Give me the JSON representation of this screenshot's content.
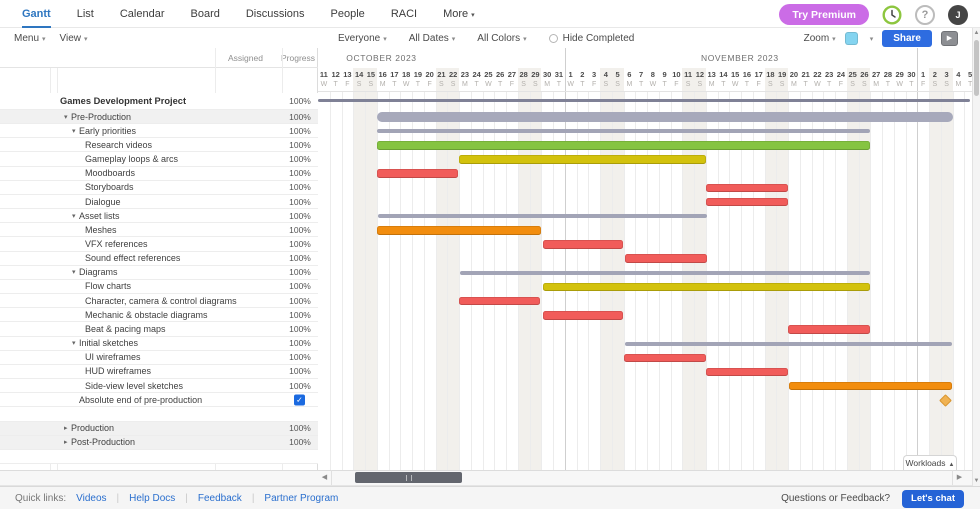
{
  "nav": {
    "tabs": [
      {
        "label": "Gantt",
        "active": true
      },
      {
        "label": "List",
        "active": false
      },
      {
        "label": "Calendar",
        "active": false
      },
      {
        "label": "Board",
        "active": false
      },
      {
        "label": "Discussions",
        "active": false
      },
      {
        "label": "People",
        "active": false
      },
      {
        "label": "RACI",
        "active": false
      },
      {
        "label": "More",
        "active": false,
        "caret": true
      }
    ],
    "try_premium_label": "Try Premium",
    "help_icon_glyph": "?",
    "avatar_initial": "J"
  },
  "toolbar": {
    "menu_label": "Menu",
    "view_label": "View",
    "everyone_label": "Everyone",
    "all_dates_label": "All Dates",
    "all_colors_label": "All Colors",
    "hide_completed_label": "Hide Completed",
    "zoom_label": "Zoom",
    "share_label": "Share"
  },
  "panel_columns": {
    "assigned": "Assigned",
    "progress": "Progress"
  },
  "workloads_label": "Workloads",
  "footer": {
    "quick_links_label": "Quick links:",
    "links": [
      "Videos",
      "Help Docs",
      "Feedback",
      "Partner Program"
    ],
    "question_label": "Questions or Feedback?",
    "chat_button_label": "Let's chat"
  },
  "colors": {
    "brand_blue": "#2e76c0",
    "premium_purple": "#cb6ce6",
    "share_blue": "#2e6ce0",
    "chat_blue": "#2563d6",
    "clock_green": "#8dc63f",
    "bar_green": "#85c441",
    "bar_yellow": "#d3c20d",
    "bar_red": "#f15c5a",
    "bar_orange": "#f28d0e",
    "bar_group_gray": "#a2a4b6",
    "bar_parent_gray": "#a7a9bb",
    "project_gray": "#7f8196",
    "milestone_orange": "#f0b252",
    "weekend_shade": "#f2f0ec",
    "checkbox_blue": "#1b6ae0"
  },
  "chart_data": {
    "type": "gantt",
    "title": "Games Development Project",
    "timeline": {
      "day_width": 11.75,
      "start_day_label": "Oct 11 2023 (W)",
      "months": [
        {
          "label": "OCTOBER 2023",
          "first_day": 11,
          "weekday_letters": "WTFSSMTWTFSSMTWTFSSMT",
          "label_center_day": 5.4
        },
        {
          "label": "NOVEMBER 2023",
          "first_day": 1,
          "weekday_letters": "WTFSSMTWTFSSMTWTFSSMTWTFSSMTWT",
          "label_center_day": 35.9
        },
        {
          "label": "",
          "first_day": 1,
          "weekday_letters": "FSSMT",
          "label_center_day": null
        }
      ]
    },
    "tasks": [
      {
        "id": "games-development-project",
        "label": "Games Development Project",
        "indent": 0,
        "bold": true,
        "progress": "100%",
        "bar": {
          "kind": "proj",
          "start": 0,
          "end": 55.5,
          "color_key": "project_gray"
        }
      },
      {
        "id": "pre-production",
        "label": "Pre-Production",
        "indent": 1,
        "caret": "down",
        "shaded": true,
        "progress": "100%",
        "bar": {
          "kind": "pill",
          "start": 5.0,
          "end": 54.0,
          "color_key": "bar_parent_gray"
        }
      },
      {
        "id": "early-priorities",
        "label": "Early priorities",
        "indent": 2,
        "caret": "down",
        "progress": "100%",
        "bar": {
          "kind": "group",
          "start": 5.0,
          "end": 47.0,
          "color_key": "bar_group_gray"
        }
      },
      {
        "id": "research-videos",
        "label": "Research videos",
        "indent": 3,
        "progress": "100%",
        "bar": {
          "kind": "task",
          "start": 5.0,
          "end": 47.0,
          "color_key": "bar_green"
        }
      },
      {
        "id": "gameplay-loops-arcs",
        "label": "Gameplay loops & arcs",
        "indent": 3,
        "progress": "100%",
        "bar": {
          "kind": "task",
          "start": 12.0,
          "end": 33.0,
          "color_key": "bar_yellow"
        }
      },
      {
        "id": "moodboards",
        "label": "Moodboards",
        "indent": 3,
        "progress": "100%",
        "bar": {
          "kind": "task",
          "start": 5.0,
          "end": 11.9,
          "color_key": "bar_red"
        }
      },
      {
        "id": "storyboards",
        "label": "Storyboards",
        "indent": 3,
        "progress": "100%",
        "bar": {
          "kind": "task",
          "start": 33.0,
          "end": 40.0,
          "color_key": "bar_red"
        }
      },
      {
        "id": "dialogue",
        "label": "Dialogue",
        "indent": 3,
        "progress": "100%",
        "bar": {
          "kind": "task",
          "start": 33.0,
          "end": 40.0,
          "color_key": "bar_red"
        }
      },
      {
        "id": "asset-lists",
        "label": "Asset lists",
        "indent": 2,
        "caret": "down",
        "progress": "100%",
        "bar": {
          "kind": "group",
          "start": 5.1,
          "end": 33.1,
          "color_key": "bar_group_gray"
        }
      },
      {
        "id": "meshes",
        "label": "Meshes",
        "indent": 3,
        "progress": "100%",
        "bar": {
          "kind": "task",
          "start": 5.0,
          "end": 19.0,
          "color_key": "bar_orange"
        }
      },
      {
        "id": "vfx-references",
        "label": "VFX references",
        "indent": 3,
        "progress": "100%",
        "bar": {
          "kind": "task",
          "start": 19.15,
          "end": 26.0,
          "color_key": "bar_red"
        }
      },
      {
        "id": "sound-effect-references",
        "label": "Sound effect references",
        "indent": 3,
        "progress": "100%",
        "bar": {
          "kind": "task",
          "start": 26.1,
          "end": 33.1,
          "color_key": "bar_red"
        }
      },
      {
        "id": "diagrams",
        "label": "Diagrams",
        "indent": 2,
        "caret": "down",
        "progress": "100%",
        "bar": {
          "kind": "group",
          "start": 12.05,
          "end": 47.0,
          "color_key": "bar_group_gray"
        }
      },
      {
        "id": "flow-charts",
        "label": "Flow charts",
        "indent": 3,
        "progress": "100%",
        "bar": {
          "kind": "task",
          "start": 19.15,
          "end": 47.0,
          "color_key": "bar_yellow"
        }
      },
      {
        "id": "character-camera-control-diagrams",
        "label": "Character, camera & control diagrams",
        "indent": 3,
        "progress": "100%",
        "bar": {
          "kind": "task",
          "start": 12.0,
          "end": 18.9,
          "color_key": "bar_red"
        }
      },
      {
        "id": "mechanic-obstacle-diagrams",
        "label": "Mechanic & obstacle diagrams",
        "indent": 3,
        "progress": "100%",
        "bar": {
          "kind": "task",
          "start": 19.15,
          "end": 26.0,
          "color_key": "bar_red"
        }
      },
      {
        "id": "beat-pacing-maps",
        "label": "Beat & pacing maps",
        "indent": 3,
        "progress": "100%",
        "bar": {
          "kind": "task",
          "start": 40.0,
          "end": 47.0,
          "color_key": "bar_red"
        }
      },
      {
        "id": "initial-sketches",
        "label": "Initial sketches",
        "indent": 2,
        "caret": "down",
        "progress": "100%",
        "bar": {
          "kind": "group",
          "start": 26.1,
          "end": 54.0,
          "color_key": "bar_group_gray"
        }
      },
      {
        "id": "ui-wireframes",
        "label": "UI wireframes",
        "indent": 3,
        "progress": "100%",
        "bar": {
          "kind": "task",
          "start": 26.0,
          "end": 33.0,
          "color_key": "bar_red"
        }
      },
      {
        "id": "hud-wireframes",
        "label": "HUD wireframes",
        "indent": 3,
        "progress": "100%",
        "bar": {
          "kind": "task",
          "start": 33.0,
          "end": 40.0,
          "color_key": "bar_red"
        }
      },
      {
        "id": "side-view-level-sketches",
        "label": "Side-view level sketches",
        "indent": 3,
        "progress": "100%",
        "bar": {
          "kind": "task",
          "start": 40.1,
          "end": 54.0,
          "color_key": "bar_orange"
        }
      },
      {
        "id": "absolute-end-of-pre-production",
        "label": "Absolute end of pre-production",
        "indent": 2,
        "progress": "checked",
        "milestone": {
          "day": 53.4,
          "color_key": "milestone_orange"
        }
      },
      {
        "id": "spacer-1",
        "label": "",
        "spacer": true
      },
      {
        "id": "production",
        "label": "Production",
        "indent": 1,
        "caret": "right",
        "shaded": true,
        "progress": "100%"
      },
      {
        "id": "post-production",
        "label": "Post-Production",
        "indent": 1,
        "caret": "right",
        "shaded": true,
        "progress": "100%"
      },
      {
        "id": "spacer-2",
        "label": "",
        "spacer": true
      }
    ]
  }
}
